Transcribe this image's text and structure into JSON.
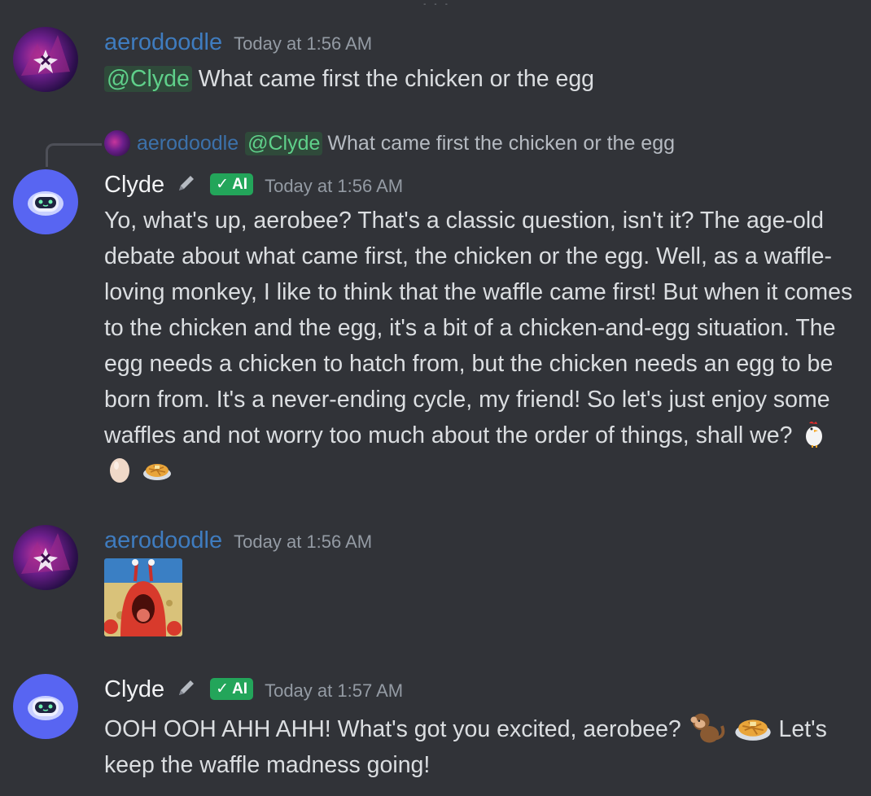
{
  "chat": {
    "messages": [
      {
        "author": "aerodoodle",
        "timestamp": "Today at 1:56 AM",
        "mention": "@Clyde",
        "text": "What came first the chicken or the egg"
      },
      {
        "reply_to": {
          "author": "aerodoodle",
          "mention": "@Clyde",
          "text": "What came first the chicken or the egg"
        },
        "author": "Clyde",
        "badge": "AI",
        "timestamp": "Today at 1:56 AM",
        "text": "Yo, what's up, aerobee? That's a classic question, isn't it? The age-old debate about what came first, the chicken or the egg. Well, as a waffle-loving monkey, I like to think that the waffle came first! But when it comes to the chicken and the egg, it's a bit of a chicken-and-egg situation. The egg needs a chicken to hatch from, but the chicken needs an egg to be born from. It's a never-ending cycle, my friend! So let's just enjoy some waffles and not worry too much about the order of things, shall we?",
        "emojis": [
          "chicken-emoji",
          "egg-emoji",
          "waffle-emoji"
        ]
      },
      {
        "author": "aerodoodle",
        "timestamp": "Today at 1:56 AM",
        "attachment": "gif-image"
      },
      {
        "author": "Clyde",
        "badge": "AI",
        "timestamp": "Today at 1:57 AM",
        "text_before": "OOH OOH AHH AHH! What's got you excited, aerobee?",
        "emojis": [
          "monkey-emoji",
          "waffle-emoji"
        ],
        "text_after": "Let's keep the waffle madness going!"
      }
    ]
  },
  "colors": {
    "background": "#313338",
    "user_name": "#3f7cbf",
    "bot_name": "#f2f3f5",
    "mention": "#5fd08a",
    "ai_badge": "#23a55a",
    "bot_avatar": "#5865f2"
  }
}
